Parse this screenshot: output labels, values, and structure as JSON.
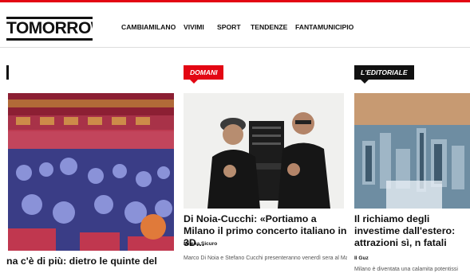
{
  "header": {
    "logo": "TOMORROW",
    "nav": [
      "CAMBIAMILANO",
      "VIVIMI",
      "SPORT",
      "TENDENZE",
      "FANTAMUNICIPIO"
    ]
  },
  "articles": [
    {
      "headline": "na c'è di più: dietro le quinte del"
    },
    {
      "tag": "DOMANI",
      "headline": "Di Noia-Cucchi: «Portiamo a Milano il primo concerto italiano in 3D...",
      "author": "Milena Sicuro",
      "excerpt": "Marco Di Noia e Stefano Cucchi presenteranno venerdì sera al Mare Culturale Urbano Elettro Acqua 3D Live, il"
    },
    {
      "tag": "L'EDITORIALE",
      "headline": "Il richiamo degli investime dall'estero: attrazioni sì, n fatali",
      "author": "Il Guz",
      "excerpt": "Milano è diventata una calamita potentissi"
    }
  ],
  "colors": {
    "accent": "#e30613",
    "tag_dark": "#111111"
  }
}
